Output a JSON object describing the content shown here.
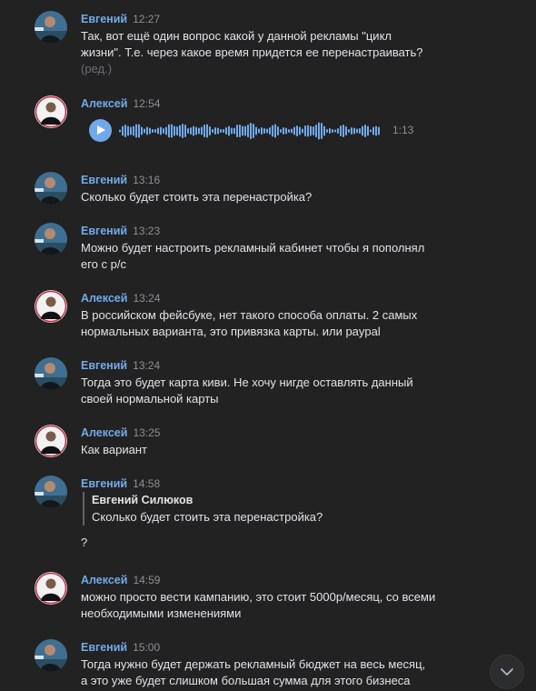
{
  "messages": [
    {
      "author": "Евгений",
      "avatar": "avatar-evgeniy",
      "time": "12:27",
      "text_lines": [
        "Так, вот ещё один вопрос какой у данной рекламы \"цикл",
        "жизни\". Т.е. через какое время придется ее перенастраивать?"
      ],
      "edited": "(ред.)"
    },
    {
      "author": "Алексей",
      "avatar": "avatar-aleksey",
      "time": "12:54",
      "voice": {
        "duration": "1:13",
        "play_icon": "play-icon"
      }
    },
    {
      "author": "Евгений",
      "avatar": "avatar-evgeniy",
      "time": "13:16",
      "text_lines": [
        "Сколько будет стоить эта перенастройка?"
      ]
    },
    {
      "author": "Евгений",
      "avatar": "avatar-evgeniy",
      "time": "13:23",
      "text_lines": [
        "Можно будет настроить рекламный кабинет чтобы я пополнял",
        "его с р/с"
      ]
    },
    {
      "author": "Алексей",
      "avatar": "avatar-aleksey",
      "time": "13:24",
      "text_lines": [
        "В российском фейсбуке, нет такого способа оплаты. 2 самых",
        "нормальных варианта, это привязка карты. или paypal"
      ]
    },
    {
      "author": "Евгений",
      "avatar": "avatar-evgeniy",
      "time": "13:24",
      "text_lines": [
        "Тогда это будет карта киви. Не хочу нигде оставлять данный",
        "своей нормальной карты"
      ]
    },
    {
      "author": "Алексей",
      "avatar": "avatar-aleksey",
      "time": "13:25",
      "text_lines": [
        "Как вариант"
      ]
    },
    {
      "author": "Евгений",
      "avatar": "avatar-evgeniy",
      "time": "14:58",
      "quote": {
        "author": "Евгений Силюков",
        "text": "Сколько будет стоить эта перенастройка?"
      },
      "text_lines": [
        "?"
      ]
    },
    {
      "author": "Алексей",
      "avatar": "avatar-aleksey",
      "time": "14:59",
      "text_lines": [
        "можно просто вести кампанию, это стоит 5000р/месяц, со всеми",
        "необходимыми изменениями"
      ]
    },
    {
      "author": "Евгений",
      "avatar": "avatar-evgeniy",
      "time": "15:00",
      "text_lines": [
        "Тогда нужно будет держать рекламный бюджет на весь месяц,",
        "а это уже будет слишком большая сумма для этого бизнеса"
      ]
    }
  ],
  "scroll_button": {
    "icon": "chevron-down-icon"
  },
  "colors": {
    "background": "#222222",
    "author": "#71aaeb",
    "text": "#e1e3e6",
    "time": "#8d8f93",
    "accent": "#71aaeb"
  }
}
